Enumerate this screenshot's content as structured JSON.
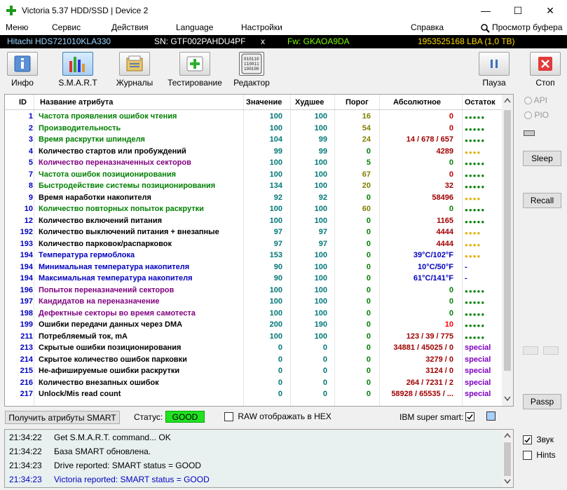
{
  "window": {
    "title": "Victoria 5.37 HDD/SSD | Device 2",
    "minimize": "—",
    "maximize": "☐",
    "close": "✕"
  },
  "menu": {
    "items": [
      "Меню",
      "Сервис",
      "Действия",
      "Language",
      "Настройки"
    ],
    "help": "Справка",
    "buffer_view": "Просмотр буфера"
  },
  "device": {
    "model": "Hitachi HDS721010KLA330",
    "serial": "SN: GTF002PAHDU4PF",
    "x": "x",
    "firmware": "Fw: GKAOA9DA",
    "lba": "1953525168 LBA (1,0 TB)"
  },
  "toolbar": {
    "info": "Инфо",
    "smart": "S.M.A.R.T",
    "journals": "Журналы",
    "testing": "Тестирование",
    "editor": "Редактор",
    "pause": "Пауза",
    "stop": "Стоп",
    "editor_icon_text": "010110\n110011\n100100\n0001"
  },
  "table": {
    "headers": {
      "id": "ID",
      "name": "Название атрибута",
      "value": "Значение",
      "worst": "Худшее",
      "threshold": "Порог",
      "raw": "Абсолютное",
      "health": "Остаток"
    },
    "rows": [
      {
        "id": "1",
        "name": "Частота проявления ошибок чтения",
        "value": "100",
        "worst": "100",
        "thr": "16",
        "raw": "0",
        "health": "●●●●●",
        "nc": "#008000",
        "hc": "#008000",
        "rc": "#c00000",
        "tc": "#808000"
      },
      {
        "id": "2",
        "name": "Производительность",
        "value": "100",
        "worst": "100",
        "thr": "54",
        "raw": "0",
        "health": "●●●●●",
        "nc": "#008000",
        "hc": "#008000",
        "rc": "#c00000",
        "tc": "#808000"
      },
      {
        "id": "3",
        "name": "Время раскрутки шпинделя",
        "value": "104",
        "worst": "99",
        "thr": "24",
        "raw": "14 / 678 / 657",
        "health": "●●●●●",
        "nc": "#008000",
        "hc": "#008000",
        "rc": "#a00000",
        "tc": "#808000"
      },
      {
        "id": "4",
        "name": "Количество стартов или пробуждений",
        "value": "99",
        "worst": "99",
        "thr": "0",
        "raw": "4289",
        "health": "●●●●",
        "nc": "#000000",
        "hc": "#e0b000",
        "rc": "#a00000",
        "tc": "#008000"
      },
      {
        "id": "5",
        "name": "Количество переназначенных секторов",
        "value": "100",
        "worst": "100",
        "thr": "5",
        "raw": "0",
        "health": "●●●●●",
        "nc": "#800080",
        "hc": "#008000",
        "rc": "#008000",
        "tc": "#008000"
      },
      {
        "id": "7",
        "name": "Частота ошибок позиционирования",
        "value": "100",
        "worst": "100",
        "thr": "67",
        "raw": "0",
        "health": "●●●●●",
        "nc": "#008000",
        "hc": "#008000",
        "rc": "#c00000",
        "tc": "#808000"
      },
      {
        "id": "8",
        "name": "Быстродействие системы позиционирования",
        "value": "134",
        "worst": "100",
        "thr": "20",
        "raw": "32",
        "health": "●●●●●",
        "nc": "#008000",
        "hc": "#008000",
        "rc": "#a00000",
        "tc": "#808000"
      },
      {
        "id": "9",
        "name": "Время наработки накопителя",
        "value": "92",
        "worst": "92",
        "thr": "0",
        "raw": "58496",
        "health": "●●●●",
        "nc": "#000000",
        "hc": "#e0b000",
        "rc": "#a00000",
        "tc": "#008000"
      },
      {
        "id": "10",
        "name": "Количество повторных попыток раскрутки",
        "value": "100",
        "worst": "100",
        "thr": "60",
        "raw": "0",
        "health": "●●●●●",
        "nc": "#008000",
        "hc": "#008000",
        "rc": "#008000",
        "tc": "#808000"
      },
      {
        "id": "12",
        "name": "Количество включений питания",
        "value": "100",
        "worst": "100",
        "thr": "0",
        "raw": "1165",
        "health": "●●●●●",
        "nc": "#000000",
        "hc": "#008000",
        "rc": "#a00000",
        "tc": "#008000"
      },
      {
        "id": "192",
        "name": "Количество выключений питания + внезапные",
        "value": "97",
        "worst": "97",
        "thr": "0",
        "raw": "4444",
        "health": "●●●●",
        "nc": "#000000",
        "hc": "#e0b000",
        "rc": "#a00000",
        "tc": "#008000"
      },
      {
        "id": "193",
        "name": "Количество парковок/распарковок",
        "value": "97",
        "worst": "97",
        "thr": "0",
        "raw": "4444",
        "health": "●●●●",
        "nc": "#000000",
        "hc": "#e0b000",
        "rc": "#a00000",
        "tc": "#008000"
      },
      {
        "id": "194",
        "name": "Температура гермоблока",
        "value": "153",
        "worst": "100",
        "thr": "0",
        "raw": "39°C/102°F",
        "health": "●●●●",
        "nc": "#0000c0",
        "hc": "#e0b000",
        "rc": "#0000c0",
        "tc": "#008000"
      },
      {
        "id": "194",
        "name": "Минимальная температура накопителя",
        "value": "90",
        "worst": "100",
        "thr": "0",
        "raw": "10°C/50°F",
        "health": "-",
        "nc": "#0000c0",
        "hc": "#0000c0",
        "rc": "#0000c0",
        "tc": "#008000"
      },
      {
        "id": "194",
        "name": "Максимальная температура накопителя",
        "value": "90",
        "worst": "100",
        "thr": "0",
        "raw": "61°C/141°F",
        "health": "-",
        "nc": "#0000c0",
        "hc": "#0000c0",
        "rc": "#0000c0",
        "tc": "#008000"
      },
      {
        "id": "196",
        "name": "Попыток переназначений секторов",
        "value": "100",
        "worst": "100",
        "thr": "0",
        "raw": "0",
        "health": "●●●●●",
        "nc": "#800080",
        "hc": "#008000",
        "rc": "#008000",
        "tc": "#008000"
      },
      {
        "id": "197",
        "name": "Кандидатов на переназначение",
        "value": "100",
        "worst": "100",
        "thr": "0",
        "raw": "0",
        "health": "●●●●●",
        "nc": "#800080",
        "hc": "#008000",
        "rc": "#008000",
        "tc": "#008000"
      },
      {
        "id": "198",
        "name": "Дефектные секторы во время самотеста",
        "value": "100",
        "worst": "100",
        "thr": "0",
        "raw": "0",
        "health": "●●●●●",
        "nc": "#800080",
        "hc": "#008000",
        "rc": "#008000",
        "tc": "#008000"
      },
      {
        "id": "199",
        "name": "Ошибки передачи данных через DMA",
        "value": "200",
        "worst": "190",
        "thr": "0",
        "raw": "10",
        "health": "●●●●●",
        "nc": "#000000",
        "hc": "#008000",
        "rc": "#ff0000",
        "tc": "#008000"
      },
      {
        "id": "211",
        "name": "Потребляемый ток, mA",
        "value": "100",
        "worst": "100",
        "thr": "0",
        "raw": "123 / 39 / 775",
        "health": "●●●●●",
        "nc": "#000000",
        "hc": "#008000",
        "rc": "#a00000",
        "tc": "#008000"
      },
      {
        "id": "213",
        "name": "Скрытые ошибки позиционирования",
        "value": "0",
        "worst": "0",
        "thr": "0",
        "raw": "34881 / 45025 / 0",
        "health": "special",
        "nc": "#000000",
        "hc": "#8000c0",
        "rc": "#a00000",
        "tc": "#008000"
      },
      {
        "id": "214",
        "name": "Скрытое количество ошибок парковки",
        "value": "0",
        "worst": "0",
        "thr": "0",
        "raw": "3279 / 0",
        "health": "special",
        "nc": "#000000",
        "hc": "#8000c0",
        "rc": "#a00000",
        "tc": "#008000"
      },
      {
        "id": "215",
        "name": "Не-афишируемые ошибки раскрутки",
        "value": "0",
        "worst": "0",
        "thr": "0",
        "raw": "3124 / 0",
        "health": "special",
        "nc": "#000000",
        "hc": "#8000c0",
        "rc": "#a00000",
        "tc": "#008000"
      },
      {
        "id": "216",
        "name": "Количество внезапных ошибок",
        "value": "0",
        "worst": "0",
        "thr": "0",
        "raw": "264 / 7231 / 2",
        "health": "special",
        "nc": "#000000",
        "hc": "#8000c0",
        "rc": "#a00000",
        "tc": "#008000"
      },
      {
        "id": "217",
        "name": "Unlock/Mis read count",
        "value": "0",
        "worst": "0",
        "thr": "0",
        "raw": "58928 / 65535 / ...",
        "health": "special",
        "nc": "#000000",
        "hc": "#8000c0",
        "rc": "#a00000",
        "tc": "#008000"
      }
    ]
  },
  "right_panel": {
    "api": "API",
    "pio": "PIO",
    "sleep": "Sleep",
    "recall": "Recall",
    "passp": "Passp"
  },
  "status": {
    "get_attrs": "Получить атрибуты SMART",
    "status_label": "Статус:",
    "status_value": "GOOD",
    "raw_hex": "RAW отображать в HEX",
    "ibm": "IBM super smart:"
  },
  "log": [
    {
      "time": "21:34:22",
      "msg": "Get S.M.A.R.T. command... OK",
      "color": "#000000"
    },
    {
      "time": "21:34:22",
      "msg": "База SMART обновлена.",
      "color": "#000000"
    },
    {
      "time": "21:34:23",
      "msg": "Drive reported: SMART status = GOOD",
      "color": "#000000"
    },
    {
      "time": "21:34:23",
      "msg": "Victoria reported: SMART status = GOOD",
      "color": "#0000c0"
    }
  ],
  "log_options": {
    "sound": "Звук",
    "hints": "Hints"
  }
}
